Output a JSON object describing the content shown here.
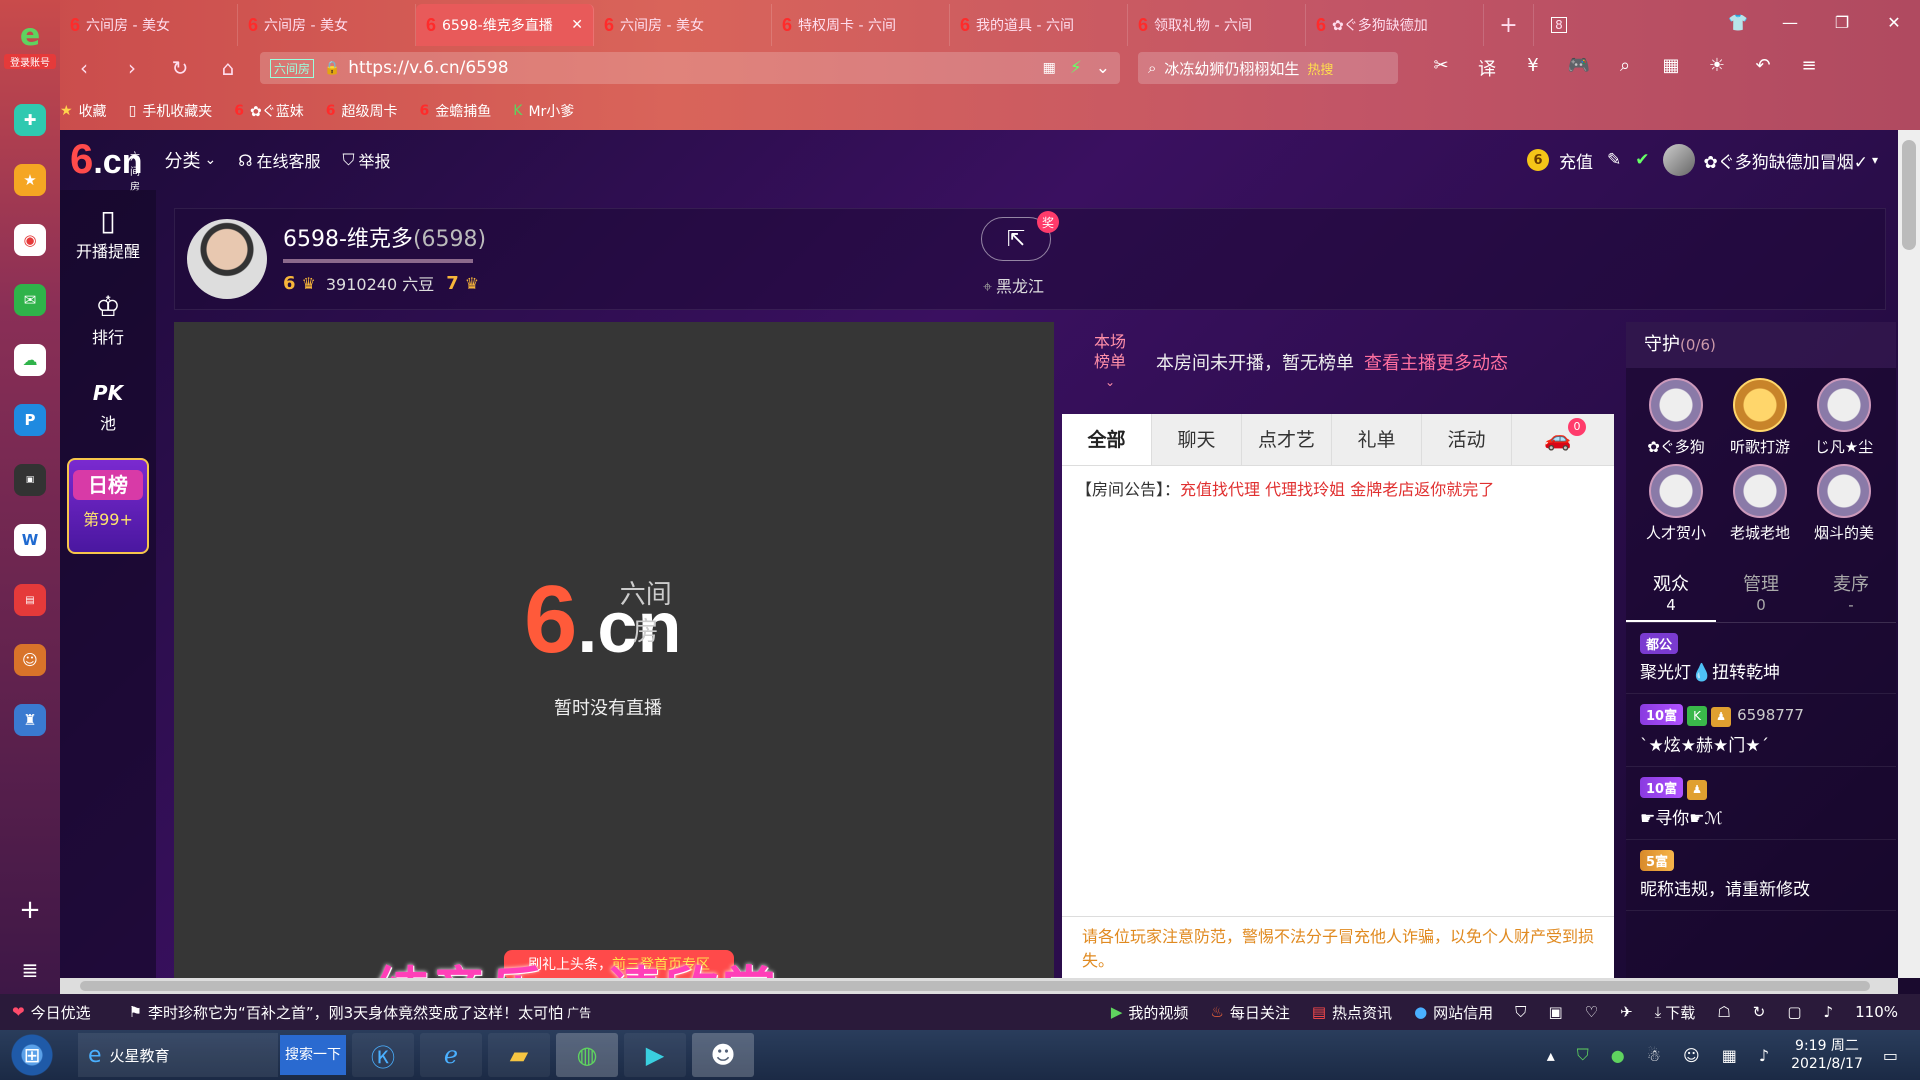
{
  "browser": {
    "tabs": [
      {
        "label": "六间房 - 美女",
        "active": false
      },
      {
        "label": "六间房 - 美女",
        "active": false
      },
      {
        "label": "6598-维克多直播",
        "active": true
      },
      {
        "label": "六间房 - 美女",
        "active": false
      },
      {
        "label": "特权周卡 - 六间",
        "active": false
      },
      {
        "label": "我的道具 - 六间",
        "active": false
      },
      {
        "label": "领取礼物 - 六间",
        "active": false
      },
      {
        "label": "✿ぐ多狗缺德加",
        "active": false
      }
    ],
    "new_tab": "+",
    "tab_count": "8",
    "address_badge": "六间房",
    "url": "https://v.6.cn/6598",
    "search_text": "冰冻幼狮仍栩栩如生",
    "search_hot": "热搜",
    "bookmarks": [
      {
        "label": "收藏"
      },
      {
        "label": "手机收藏夹"
      },
      {
        "label": "✿ぐ蓝妹"
      },
      {
        "label": "超级周卡"
      },
      {
        "label": "金蟾捕鱼"
      },
      {
        "label": "Mr小爹"
      }
    ]
  },
  "login": {
    "label": "登录账号",
    "logo": "e"
  },
  "site": {
    "logo_sub": "六间房",
    "logo_six": "6",
    "logo_cn": ".cn",
    "header": {
      "category": "分类",
      "service": "在线客服",
      "report": "举报",
      "recharge": "充值",
      "coin": "6",
      "username": "✿ぐ多狗缺德加冒烟✓"
    },
    "mini_nav": [
      {
        "label": "开播提醒"
      },
      {
        "label": "排行"
      },
      {
        "label": "池",
        "top": "PK"
      }
    ],
    "daily": {
      "title": "日榜",
      "rank": "第99+"
    },
    "host": {
      "name": "6598-维克多",
      "room_id": "(6598)",
      "level_left": "6",
      "beans": "3910240 六豆",
      "level_right": "7",
      "location": "黑龙江",
      "share_badge": "奖"
    },
    "player": {
      "logo_sub": "六间房",
      "logo_six": "6",
      "logo_cn": ".cn",
      "no_live": "暂时没有直播",
      "promo_a": "刷礼上头条，",
      "promo_b": "前三登首页专区"
    },
    "rank": {
      "label_1": "本场",
      "label_2": "榜单",
      "text": "本房间未开播，暂无榜单",
      "link": "查看主播更多动态"
    },
    "chat": {
      "tabs": [
        "全部",
        "聊天",
        "点才艺",
        "礼单",
        "活动"
      ],
      "car_count": "0",
      "notice_label": "【房间公告】：",
      "notice_text": "充值找代理 代理找玲姐 金牌老店返你就完了",
      "warning": "请各位玩家注意防范，警惕不法分子冒充他人诈骗，以免个人财产受到损失。"
    },
    "guard": {
      "title": "守护",
      "count": "(0/6)",
      "members": [
        {
          "name": "✿ぐ多狗"
        },
        {
          "name": "听歌打游"
        },
        {
          "name": "じ凡★尘"
        },
        {
          "name": "人才贺小"
        },
        {
          "name": "老城老地"
        },
        {
          "name": "烟斗的美"
        }
      ]
    },
    "audience_tabs": [
      {
        "label": "观众",
        "count": "4"
      },
      {
        "label": "管理",
        "count": "0"
      },
      {
        "label": "麦序",
        "count": "-"
      }
    ],
    "viewers": [
      {
        "tag": "都公",
        "name": "聚光灯💧扭转乾坤",
        "id": ""
      },
      {
        "tag": "10富",
        "name": "`★炫★赫★门★´",
        "id": "6598777"
      },
      {
        "tag": "10富",
        "name": "☛寻你☛ℳ",
        "id": ""
      },
      {
        "tag": "5富",
        "name": "昵称违规，请重新修改",
        "id": ""
      }
    ]
  },
  "subtitle": "纯音乐，请欣赏",
  "status_bar": {
    "left": "今日优选",
    "news": "李时珍称它为“百补之首”，刚3天身体竟然变成了这样！太可怕",
    "ad": "广告",
    "items": [
      "我的视频",
      "每日关注",
      "热点资讯",
      "网站信用"
    ],
    "download": "下载",
    "zoom": "110%"
  },
  "taskbar": {
    "ie_label": "火星教育",
    "search_btn": "搜索一下",
    "time": "9:19 周二",
    "date": "2021/8/17"
  }
}
